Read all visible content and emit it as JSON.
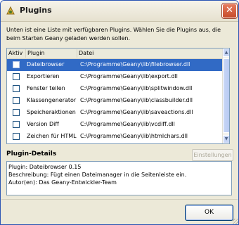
{
  "window": {
    "title": "Plugins",
    "close_symbol": "✕"
  },
  "intro_text": "Unten ist eine Liste mit verfügbaren Plugins. Wählen Sie die Plugins aus, die beim Starten Geany geladen werden sollen.",
  "plugin_list": {
    "columns": [
      "Aktiv",
      "Plugin",
      "Datei"
    ],
    "rows": [
      {
        "active": false,
        "name": "Dateibrowser",
        "file": "C:\\Programme\\Geany\\lib\\filebrowser.dll",
        "selected": true
      },
      {
        "active": false,
        "name": "Exportieren",
        "file": "C:\\Programme\\Geany\\lib\\export.dll",
        "selected": false
      },
      {
        "active": false,
        "name": "Fenster teilen",
        "file": "C:\\Programme\\Geany\\lib\\splitwindow.dll",
        "selected": false
      },
      {
        "active": false,
        "name": "Klassengenerator",
        "file": "C:\\Programme\\Geany\\lib\\classbuilder.dll",
        "selected": false
      },
      {
        "active": false,
        "name": "Speicheraktionen",
        "file": "C:\\Programme\\Geany\\lib\\saveactions.dll",
        "selected": false
      },
      {
        "active": false,
        "name": "Version Diff",
        "file": "C:\\Programme\\Geany\\lib\\vcdiff.dll",
        "selected": false
      },
      {
        "active": false,
        "name": "Zeichen für HTML",
        "file": "C:\\Programme\\Geany\\lib\\htmlchars.dll",
        "selected": false
      }
    ]
  },
  "details": {
    "title": "Plugin-Details",
    "settings_label": "Einstellungen",
    "lines": [
      "Plugin: Dateibrowser 0.15",
      "Beschreibung: Fügt einen Dateimanager in die Seitenleiste ein.",
      "Autor(en): Das Geany-Entwickler-Team"
    ]
  },
  "ok_label": "OK",
  "icons": {
    "app": "geany-app-icon",
    "close": "close-icon"
  },
  "colors": {
    "selection": "#316ac5",
    "list_border": "#7f9db9",
    "dialog_bg": "#ece9d8"
  }
}
